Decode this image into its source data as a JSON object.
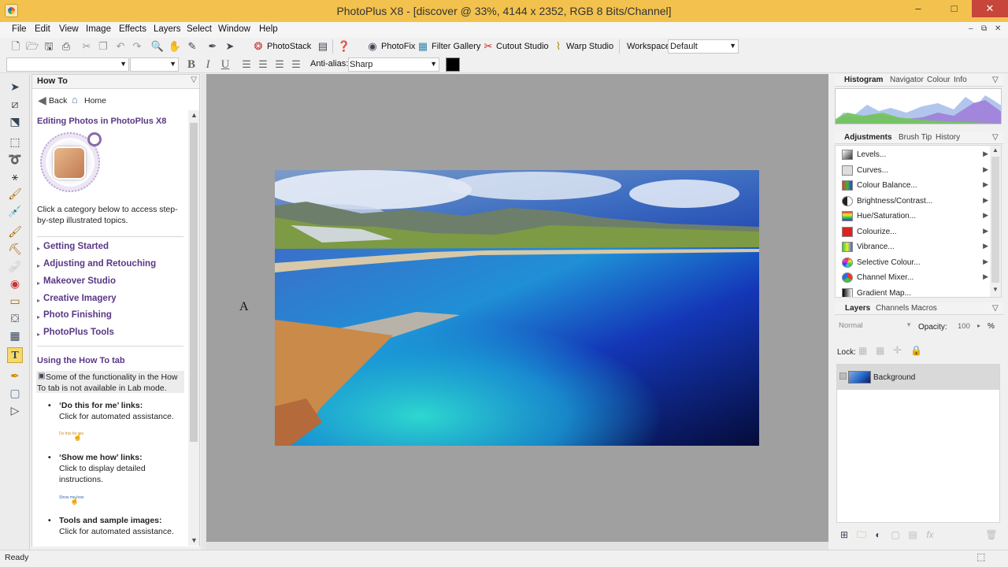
{
  "window": {
    "title": "PhotoPlus X8 - [discover @ 33%, 4144 x 2352, RGB 8 Bits/Channel]",
    "minimize": "–",
    "maximize": "□",
    "close": "✕"
  },
  "mdi": {
    "minimize": "–",
    "restore": "⧉",
    "close": "✕"
  },
  "menu": [
    "File",
    "Edit",
    "View",
    "Image",
    "Effects",
    "Layers",
    "Select",
    "Window",
    "Help"
  ],
  "toolbar": {
    "photostack": "PhotoStack",
    "photofix": "PhotoFix",
    "filter_gallery": "Filter Gallery",
    "cutout_studio": "Cutout Studio",
    "warp_studio": "Warp Studio",
    "workspace_label": "Workspace",
    "workspace_value": "Default"
  },
  "text_toolbar": {
    "font": "",
    "size": "",
    "bold": "B",
    "italic": "I",
    "underline": "U",
    "antialias_label": "Anti-alias:",
    "antialias_value": "Sharp"
  },
  "howto": {
    "tab": "How To",
    "back": "Back",
    "home": "Home",
    "heading": "Editing Photos in PhotoPlus X8",
    "intro_1": "Click a category below to access step-",
    "intro_2": "by-step illustrated topics.",
    "categories": [
      "Getting Started",
      "Adjusting and Retouching",
      "Makeover Studio",
      "Creative Imagery",
      "Photo Finishing",
      "PhotoPlus Tools"
    ],
    "using_heading": "Using the How To tab",
    "note_1": "Some of the functionality in the How",
    "note_2": "To tab is not available in Lab mode.",
    "bullets": [
      {
        "title": "‘Do this for me’ links:",
        "desc": "Click for automated assistance.",
        "sample": "Do this for me"
      },
      {
        "title": "‘Show me how’ links:",
        "desc1": "Click to display detailed",
        "desc2": "instructions.",
        "sample": "Show me how"
      },
      {
        "title": "Tools and sample images:",
        "desc": "Click for automated assistance."
      }
    ]
  },
  "canvas": {
    "cursor_glyph": "A"
  },
  "histogram_panel": {
    "tabs": [
      "Histogram",
      "Navigator",
      "Colour",
      "Info"
    ]
  },
  "adjustments_panel": {
    "tabs": [
      "Adjustments",
      "Brush Tip",
      "History"
    ],
    "items": [
      "Levels...",
      "Curves...",
      "Colour Balance...",
      "Brightness/Contrast...",
      "Hue/Saturation...",
      "Colourize...",
      "Vibrance...",
      "Selective Colour...",
      "Channel Mixer...",
      "Gradient Map..."
    ]
  },
  "layers_panel": {
    "tabs": [
      "Layers",
      "Channels",
      "Macros"
    ],
    "blend_mode": "Normal",
    "opacity_label": "Opacity:",
    "opacity_value": "100",
    "opacity_unit": "%",
    "lock_label": "Lock:",
    "layer_name": "Background"
  },
  "status": {
    "text": "Ready"
  },
  "colors": {
    "titlebar": "#f3c24e",
    "close": "#c7453a",
    "howto_link": "#5a3786",
    "canvas_bg": "#a0a0a0"
  }
}
